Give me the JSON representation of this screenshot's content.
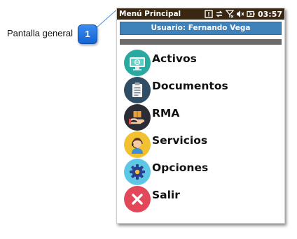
{
  "callout": {
    "label": "Pantalla general",
    "number": "1"
  },
  "statusbar": {
    "title": "Menú Principal",
    "time": "03:57",
    "icons": [
      "notification-icon",
      "data-transfer-icon",
      "no-signal-icon",
      "volume-muted-icon",
      "battery-icon"
    ]
  },
  "user": {
    "label": "Usuario: Fernando Vega"
  },
  "menu": {
    "items": [
      {
        "label": "Activos",
        "icon": "computer-icon",
        "color": "#2aa9a0"
      },
      {
        "label": "Documentos",
        "icon": "clipboard-icon",
        "color": "#2f4e66"
      },
      {
        "label": "RMA",
        "icon": "package-hand-icon",
        "color": "#2c2c35"
      },
      {
        "label": "Servicios",
        "icon": "support-agent-icon",
        "color": "#f2c131"
      },
      {
        "label": "Opciones",
        "icon": "gear-icon",
        "color": "#5ec7e6"
      },
      {
        "label": "Salir",
        "icon": "exit-x-icon",
        "color": "#e2475a"
      }
    ]
  },
  "colors": {
    "statusbar": "#3a2712",
    "userbar": "#3f82b9",
    "callout_badge": "#1f6fe0"
  }
}
